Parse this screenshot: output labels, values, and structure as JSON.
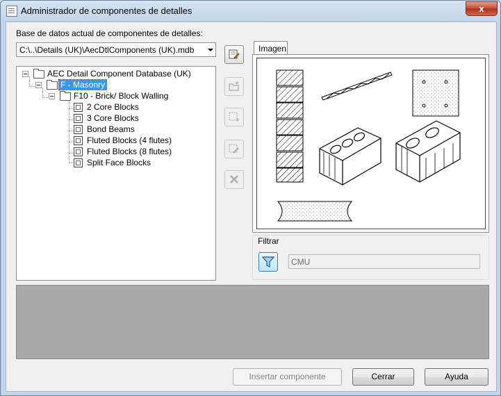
{
  "window": {
    "title": "Administrador de componentes de detalles",
    "close_glyph": "x"
  },
  "database": {
    "label": "Base de datos actual de componentes de detalles:",
    "current_value": "C:\\..\\Details (UK)\\AecDtlComponents (UK).mdb"
  },
  "tree": {
    "root": "AEC Detail Component Database (UK)",
    "division": "F - Masonry",
    "section": "F10 - Brick/ Block Walling",
    "items": [
      "2 Core Blocks",
      "3 Core Blocks",
      "Bond Beams",
      "Fluted Blocks (4 flutes)",
      "Fluted Blocks (8 flutes)",
      "Split Face Blocks"
    ]
  },
  "toolbar": {
    "icons": [
      "edit-database-icon",
      "new-category-icon",
      "new-component-icon",
      "edit-component-icon",
      "delete-icon"
    ]
  },
  "preview": {
    "tab_label": "Imagen"
  },
  "filter": {
    "label": "Filtrar",
    "value": "CMU",
    "icon": "funnel-icon"
  },
  "buttons": {
    "insert": "Insertar componente",
    "close": "Cerrar",
    "help": "Ayuda"
  },
  "colors": {
    "selection": "#3399ff",
    "description_panel": "#a9a9a9"
  }
}
